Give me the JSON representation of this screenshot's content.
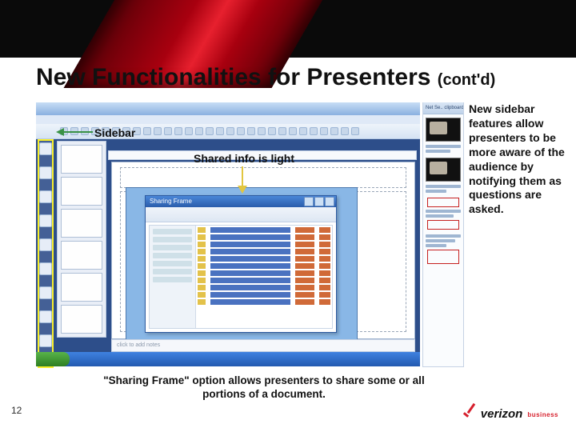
{
  "slide": {
    "title_main": "New Functionalities for Presenters ",
    "title_sub": "(cont'd)",
    "page_number": "12"
  },
  "annotations": {
    "sidebar_label": "Sidebar",
    "shared_label": "Shared info is light",
    "sharing_frame_title": "Sharing Frame"
  },
  "netpane": {
    "header": "Net Se.. clipboard"
  },
  "notes_placeholder": "click to add notes",
  "description": "New sidebar features allow presenters to be more aware of the audience by notifying them as  questions are asked.",
  "caption": "\"Sharing Frame\" option allows presenters to share some or all portions of a document.",
  "logo": {
    "brand": "verizon",
    "unit": "business"
  }
}
